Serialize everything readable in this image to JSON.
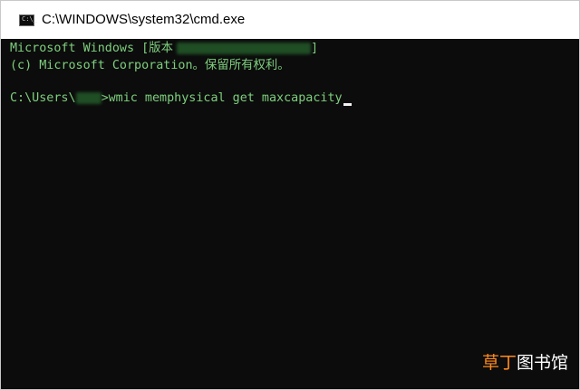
{
  "window": {
    "title": "C:\\WINDOWS\\system32\\cmd.exe",
    "icon": "terminal-icon",
    "icon_text": "C:\\_"
  },
  "console": {
    "line1": "Microsoft Windows [版本",
    "line1_tail": "]",
    "line2": "(c) Microsoft Corporation。保留所有权利。",
    "prompt_prefix": "C:\\Users\\",
    "prompt_suffix": ">",
    "command": "wmic memphysical get maxcapacity"
  },
  "watermark": {
    "accent": "草丁",
    "rest": "图书馆"
  },
  "colors": {
    "console_bg": "#0c0c0c",
    "console_text": "#7ecf7e",
    "cursor": "#f2f2f2",
    "watermark_accent": "#ff8a1f"
  }
}
